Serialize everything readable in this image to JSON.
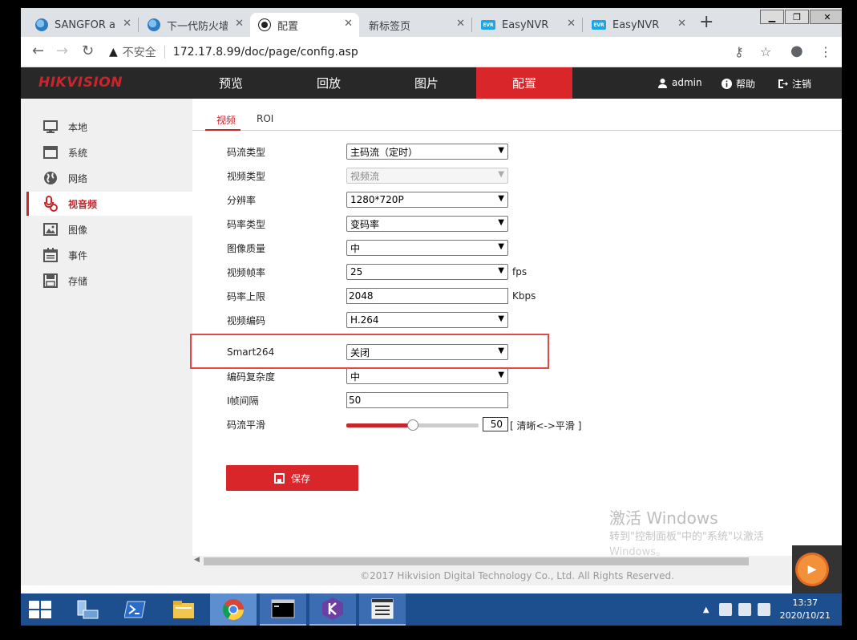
{
  "browser": {
    "tabs": [
      {
        "title": "SANGFOR al",
        "icon": "globe-icon",
        "active": false
      },
      {
        "title": "下一代防火墙",
        "icon": "globe-icon",
        "active": false
      },
      {
        "title": "配置",
        "icon": "camera-icon",
        "active": true
      },
      {
        "title": "新标签页",
        "icon": "",
        "active": false
      },
      {
        "title": "EasyNVR",
        "icon": "easynvr-icon",
        "active": false
      },
      {
        "title": "EasyNVR",
        "icon": "easynvr-icon",
        "active": false
      }
    ],
    "insecure_label": "不安全",
    "url": "172.17.8.99/doc/page/config.asp"
  },
  "app": {
    "logo": "HIKVISION",
    "nav": [
      "预览",
      "回放",
      "图片",
      "配置"
    ],
    "active_nav": "配置",
    "user": "admin",
    "help": "帮助",
    "logout": "注销"
  },
  "sidebar": {
    "items": [
      {
        "label": "本地",
        "icon": "monitor-icon"
      },
      {
        "label": "系统",
        "icon": "system-window-icon"
      },
      {
        "label": "网络",
        "icon": "network-globe-icon"
      },
      {
        "label": "视音频",
        "icon": "audio-video-icon"
      },
      {
        "label": "图像",
        "icon": "image-icon"
      },
      {
        "label": "事件",
        "icon": "calendar-icon"
      },
      {
        "label": "存储",
        "icon": "storage-icon"
      }
    ],
    "active": "视音频"
  },
  "subtabs": [
    "视频",
    "ROI"
  ],
  "form": {
    "stream_type": {
      "label": "码流类型",
      "value": "主码流（定时）"
    },
    "video_type": {
      "label": "视频类型",
      "value": "视频流"
    },
    "resolution": {
      "label": "分辨率",
      "value": "1280*720P"
    },
    "bitrate_type": {
      "label": "码率类型",
      "value": "变码率"
    },
    "image_quality": {
      "label": "图像质量",
      "value": "中"
    },
    "frame_rate": {
      "label": "视频帧率",
      "value": "25",
      "unit": "fps"
    },
    "max_bitrate": {
      "label": "码率上限",
      "value": "2048",
      "unit": "Kbps"
    },
    "video_encoding": {
      "label": "视频编码",
      "value": "H.264"
    },
    "smart264": {
      "label": "Smart264",
      "value": "关闭"
    },
    "encoding_complexity": {
      "label": "编码复杂度",
      "value": "中"
    },
    "i_frame_interval": {
      "label": "I帧间隔",
      "value": "50"
    },
    "stream_smoothing": {
      "label": "码流平滑",
      "value": "50",
      "fraction": 0.5,
      "hint": "[ 清晰<->平滑 ]"
    }
  },
  "save_label": "保存",
  "footer": "©2017 Hikvision Digital Technology Co., Ltd. All Rights Reserved.",
  "watermark": {
    "title": "激活 Windows",
    "line1": "转到\"控制面板\"中的\"系统\"以激活",
    "line2": "Windows。"
  },
  "taskbar": {
    "time": "13:37",
    "date": "2020/10/21"
  },
  "colors": {
    "accent": "#d9262a",
    "nav_bg": "#282828",
    "taskbar": "#1d4f8f"
  }
}
